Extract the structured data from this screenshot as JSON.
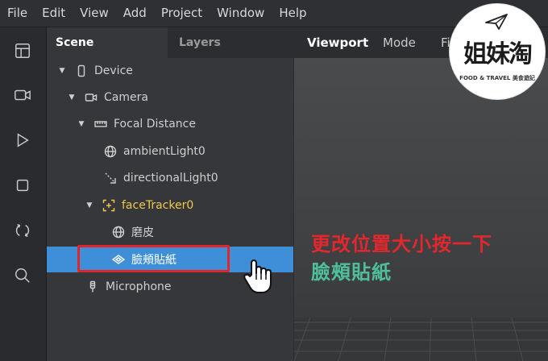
{
  "menubar": {
    "items": [
      "File",
      "Edit",
      "View",
      "Add",
      "Project",
      "Window",
      "Help"
    ]
  },
  "toolrail": {
    "icons": [
      "layout-icon",
      "video-icon",
      "play-icon",
      "stop-icon",
      "refresh-icon",
      "search-icon"
    ]
  },
  "scene_panel": {
    "tabs": [
      "Scene",
      "Layers"
    ],
    "tree": [
      {
        "label": "Device",
        "icon": "phone-icon",
        "expanded": true
      },
      {
        "label": "Camera",
        "icon": "camera-icon",
        "expanded": true
      },
      {
        "label": "Focal Distance",
        "icon": "ruler-icon",
        "expanded": true
      },
      {
        "label": "ambientLight0",
        "icon": "globe-icon"
      },
      {
        "label": "directionalLight0",
        "icon": "directional-light-icon"
      },
      {
        "label": "faceTracker0",
        "icon": "face-tracker-icon",
        "expanded": true
      },
      {
        "label": "磨皮",
        "icon": "globe-icon"
      },
      {
        "label": "臉頰貼紙",
        "icon": "plane-icon",
        "selected": true
      },
      {
        "label": "Microphone",
        "icon": "microphone-icon"
      }
    ]
  },
  "viewport": {
    "tabs": [
      "Viewport",
      "Mode",
      "Fi"
    ]
  },
  "annotation": {
    "line1": "更改位置大小按一下",
    "line2": "臉頰貼紙"
  },
  "logo": {
    "main": "姐妹淘",
    "sub": "FOOD & TRAVEL 美食遊記"
  },
  "colors": {
    "selection": "#3e8fd8",
    "highlight_box": "#e0262a",
    "annotation_red": "#e3272d",
    "annotation_green": "#4fbf9a",
    "face_tracker": "#f1c84b"
  }
}
